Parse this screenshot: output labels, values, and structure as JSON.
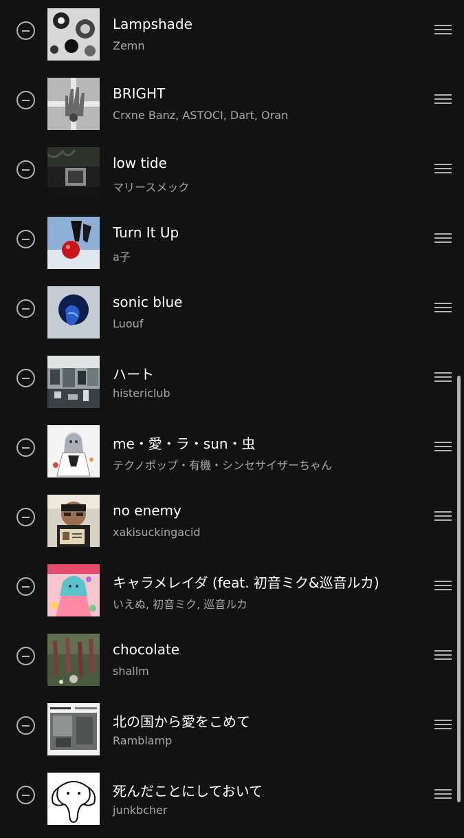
{
  "tracks": [
    {
      "title": "Lampshade",
      "artist": "Zemn",
      "art_icon": "abstract-gears-art"
    },
    {
      "title": "BRIGHT",
      "artist": "Crxne Banz, ASTOCI, Dart, Oran",
      "art_icon": "hand-grayscale-art"
    },
    {
      "title": "low tide",
      "artist": "マリースメック",
      "art_icon": "dark-room-art"
    },
    {
      "title": "Turn It Up",
      "artist": "a子",
      "art_icon": "red-apple-art"
    },
    {
      "title": "sonic blue",
      "artist": "Luouf",
      "art_icon": "blue-orb-art"
    },
    {
      "title": "ハート",
      "artist": "histericlub",
      "art_icon": "glitch-building-art"
    },
    {
      "title": "me・愛・ラ・sun・虫",
      "artist": "テクノポップ・有機・シンセサイザーちゃん",
      "art_icon": "anime-girl-art"
    },
    {
      "title": "no enemy",
      "artist": "xakisuckingacid",
      "art_icon": "man-with-id-card-art"
    },
    {
      "title": "キャラメレイダ (feat. 初音ミク&巡音ルカ)",
      "artist": "いえぬ, 初音ミク, 巡音ルカ",
      "art_icon": "colorful-anime-art"
    },
    {
      "title": "chocolate",
      "artist": "shallm",
      "art_icon": "forest-figures-art"
    },
    {
      "title": "北の国から愛をこめて",
      "artist": "Ramblamp",
      "art_icon": "grey-photo-art"
    },
    {
      "title": "死んだことにしておいて",
      "artist": "junkbcher",
      "art_icon": "elephant-sketch-art"
    }
  ],
  "colors": {
    "background": "#121212",
    "title_text": "#ffffff",
    "artist_text": "#a7a7a7",
    "icon": "#b3b3b3"
  }
}
